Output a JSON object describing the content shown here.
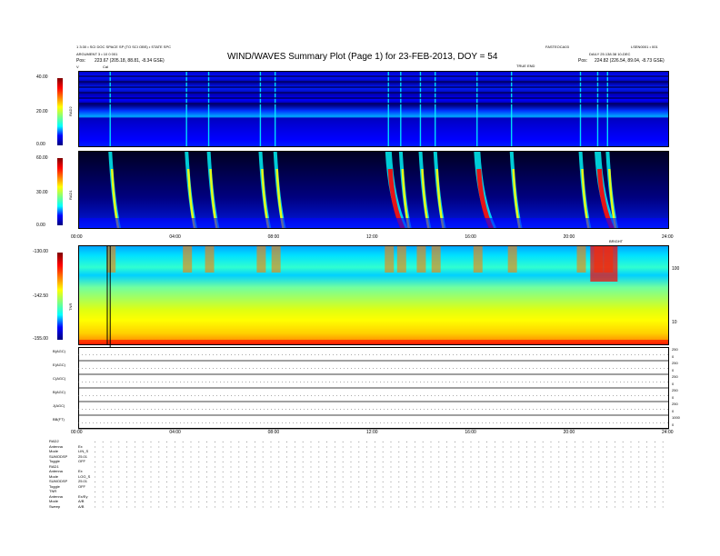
{
  "header": {
    "left_line1": "1 3:30 • SCI DOC SPACE SP (TO SCI OBS) • STATE SPC",
    "left_line2": "ARGUMENT 3 • 10 0 001",
    "left_line3_label": "Pos:",
    "left_line3_value": "223.67 (205.18, 88.81, -8.34 GSE)",
    "right_line1_a": "FASTEOCA03",
    "right_line1_b": "LSEN0001 • 001",
    "right_line2": "DAILY 25.138.38 10-DEC",
    "right_line3_label": "Pos:",
    "right_line3_value": "224.82 (226.54, 89.04, -8.73 GSE)",
    "title": "WIND/WAVES Summary Plot (Page 1) for 23-FEB-2013, DOY = 54",
    "top_right_label": "TRUE END",
    "y_tick_top": "V",
    "cal_label": "Cal"
  },
  "rad2": {
    "label": "RAD2",
    "ticks": [
      "40.00",
      "20.00",
      "0.00"
    ]
  },
  "rad1": {
    "label": "RAD1",
    "ticks": [
      "60.00",
      "30.00",
      "0.00"
    ]
  },
  "time_axis_top": [
    "00:00",
    "04:00",
    "08:00",
    "12:00",
    "16:00",
    "20:00",
    "24:00"
  ],
  "tnr": {
    "label": "TNR",
    "ticks": [
      "-130.00",
      "-142.50",
      "-155.00"
    ],
    "right_ticks": [
      "100",
      "10"
    ],
    "top_right_label": "BRIGHT"
  },
  "lines": {
    "labels": [
      "B(AGC)",
      "E(AGC)",
      "C(AGC)",
      "B(AGC)",
      "J(AGC)",
      "BB(FT)"
    ],
    "right_ticks": [
      "250",
      "0",
      "250",
      "0",
      "250",
      "0",
      "250",
      "0",
      "250",
      "0",
      "1000",
      "0"
    ]
  },
  "time_axis_bottom": [
    "00:00",
    "04:00",
    "08:00",
    "12:00",
    "16:00",
    "20:00",
    "24:00"
  ],
  "footer": {
    "rows": [
      {
        "label": "RAD2",
        "value": ""
      },
      {
        "label": "Antenna",
        "value": "Ex"
      },
      {
        "label": "Mode",
        "value": "LIN_S"
      },
      {
        "label": "SUMODSP",
        "value": "25.01"
      },
      {
        "label": "Toggle",
        "value": "OFF"
      },
      {
        "label": "RAD1",
        "value": ""
      },
      {
        "label": "Antenna",
        "value": "Ex"
      },
      {
        "label": "Mode",
        "value": "LOG_S"
      },
      {
        "label": "SUMODSP",
        "value": "25.01"
      },
      {
        "label": "Toggle",
        "value": "OFF"
      },
      {
        "label": "TNR",
        "value": ""
      },
      {
        "label": "Antenna",
        "value": "Ex/Ey"
      },
      {
        "label": "Mode",
        "value": "A/B"
      },
      {
        "label": "Sweep",
        "value": "A/B"
      }
    ]
  },
  "colors": {
    "deep_blue": "#00007f",
    "blue": "#0000ff",
    "cyan": "#00ffff",
    "green": "#7fff7f",
    "yellow": "#ffff00",
    "orange": "#ff7f00",
    "red": "#ff0000",
    "dark_red": "#7f0000"
  },
  "chart_data": {
    "type": "heatmap",
    "title": "WIND/WAVES Summary Plot (Page 1) for 23-FEB-2013, DOY = 54",
    "x_range_hours": [
      0,
      24
    ],
    "x_tick_labels": [
      "00:00",
      "04:00",
      "08:00",
      "12:00",
      "16:00",
      "20:00",
      "24:00"
    ],
    "panels": [
      {
        "name": "RAD2",
        "y_range": [
          0,
          40
        ],
        "y_tick_labels": [
          "40.00",
          "20.00",
          "0.00"
        ]
      },
      {
        "name": "RAD1",
        "y_range": [
          0,
          60
        ],
        "y_tick_labels": [
          "60.00",
          "30.00",
          "0.00"
        ]
      },
      {
        "name": "TNR",
        "y_range": [
          -155,
          -130
        ],
        "y_tick_labels": [
          "-130.00",
          "-142.50",
          "-155.00"
        ]
      }
    ],
    "type_iii_burst_times_hours": [
      1.3,
      4.4,
      5.3,
      7.4,
      8.0,
      12.6,
      13.1,
      13.9,
      14.5,
      16.2,
      17.6,
      20.4,
      21.1,
      21.5
    ]
  }
}
